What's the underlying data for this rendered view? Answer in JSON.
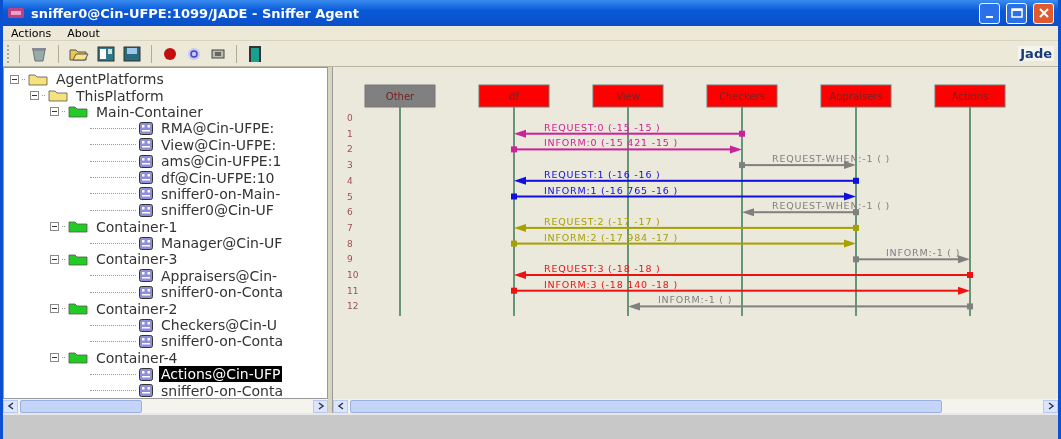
{
  "window": {
    "title": "sniffer0@Cin-UFPE:1099/JADE - Sniffer Agent"
  },
  "menu": [
    "Actions",
    "About"
  ],
  "toolbar": {
    "logo_text": "Jade"
  },
  "tree": [
    {
      "label": "AgentPlatforms",
      "kind": "folder",
      "expanded": true,
      "selected": false,
      "children": [
        {
          "label": "ThisPlatform",
          "kind": "folder",
          "expanded": true,
          "selected": false,
          "children": [
            {
              "label": "Main-Container",
              "kind": "container",
              "expanded": true,
              "selected": false,
              "children": [
                {
                  "label": "RMA@Cin-UFPE:",
                  "kind": "agent",
                  "selected": false
                },
                {
                  "label": "View@Cin-UFPE:",
                  "kind": "agent",
                  "selected": false
                },
                {
                  "label": "ams@Cin-UFPE:1",
                  "kind": "agent",
                  "selected": false
                },
                {
                  "label": "df@Cin-UFPE:10",
                  "kind": "agent",
                  "selected": false
                },
                {
                  "label": "sniffer0-on-Main-",
                  "kind": "agent",
                  "selected": false
                },
                {
                  "label": "sniffer0@Cin-UF",
                  "kind": "agent",
                  "selected": false
                }
              ]
            },
            {
              "label": "Container-1",
              "kind": "container",
              "expanded": true,
              "selected": false,
              "children": [
                {
                  "label": "Manager@Cin-UF",
                  "kind": "agent",
                  "selected": false
                }
              ]
            },
            {
              "label": "Container-3",
              "kind": "container",
              "expanded": true,
              "selected": false,
              "children": [
                {
                  "label": "Appraisers@Cin-",
                  "kind": "agent",
                  "selected": false
                },
                {
                  "label": "sniffer0-on-Conta",
                  "kind": "agent",
                  "selected": false
                }
              ]
            },
            {
              "label": "Container-2",
              "kind": "container",
              "expanded": true,
              "selected": false,
              "children": [
                {
                  "label": "Checkers@Cin-U",
                  "kind": "agent",
                  "selected": false
                },
                {
                  "label": "sniffer0-on-Conta",
                  "kind": "agent",
                  "selected": false
                }
              ]
            },
            {
              "label": "Container-4",
              "kind": "container",
              "expanded": true,
              "selected": false,
              "children": [
                {
                  "label": "Actions@Cin-UFP",
                  "kind": "agent",
                  "selected": true
                },
                {
                  "label": "sniffer0-on-Conta",
                  "kind": "agent",
                  "selected": false
                }
              ]
            }
          ]
        }
      ]
    }
  ],
  "diagram": {
    "agents": [
      {
        "name": "Other",
        "color": "#808080"
      },
      {
        "name": "df",
        "color": "#ff0000"
      },
      {
        "name": "View",
        "color": "#ff0000"
      },
      {
        "name": "Checkers",
        "color": "#ff0000"
      },
      {
        "name": "Appraisers",
        "color": "#ff0000"
      },
      {
        "name": "Actions",
        "color": "#ff0000"
      }
    ],
    "row_numbers": [
      "0",
      "1",
      "2",
      "3",
      "4",
      "5",
      "6",
      "7",
      "8",
      "9",
      "10",
      "11",
      "12"
    ],
    "messages": [
      {
        "label": "REQUEST:0 (-15 -15 )",
        "kind": "leftward",
        "covers": [
          false,
          true,
          true,
          true,
          false,
          false
        ],
        "color": "#cc2299"
      },
      {
        "label": "INFORM:0 (-15 421 -15 )",
        "kind": "rightward",
        "covers": [
          false,
          true,
          true,
          true,
          false,
          false
        ],
        "color": "#cc2299"
      },
      {
        "label": "REQUEST-WHEN:-1 ( )",
        "kind": "rightward",
        "covers": [
          false,
          false,
          false,
          true,
          true,
          false
        ],
        "color": "#808080"
      },
      {
        "label": "REQUEST:1 (-16 -16 )",
        "kind": "leftward",
        "covers": [
          false,
          true,
          true,
          true,
          true,
          false
        ],
        "color": "#1010dd"
      },
      {
        "label": "INFORM:1 (-16 765 -16 )",
        "kind": "rightward",
        "covers": [
          false,
          true,
          true,
          true,
          true,
          false
        ],
        "color": "#1010dd"
      },
      {
        "label": "REQUEST-WHEN:-1 ( )",
        "kind": "leftward",
        "covers": [
          false,
          false,
          false,
          true,
          true,
          false
        ],
        "color": "#808080"
      },
      {
        "label": "REQUEST:2 (-17 -17 )",
        "kind": "leftward",
        "covers": [
          false,
          true,
          true,
          true,
          true,
          false
        ],
        "color": "#a8a000"
      },
      {
        "label": "INFORM:2 (-17 984 -17 )",
        "kind": "rightward",
        "covers": [
          false,
          true,
          true,
          true,
          true,
          false
        ],
        "color": "#a8a000"
      },
      {
        "label": "INFORM:-1 ( )",
        "kind": "rightward",
        "covers": [
          false,
          false,
          false,
          false,
          true,
          true
        ],
        "color": "#808080"
      },
      {
        "label": "REQUEST:3 (-18 -18 )",
        "kind": "leftward",
        "covers": [
          false,
          true,
          true,
          true,
          true,
          true
        ],
        "color": "#ee1111"
      },
      {
        "label": "INFORM:3 (-18 140 -18 )",
        "kind": "rightward",
        "covers": [
          false,
          true,
          true,
          true,
          true,
          true
        ],
        "color": "#ee1111"
      },
      {
        "label": "INFORM:-1 ( )",
        "kind": "leftward",
        "covers": [
          false,
          false,
          true,
          true,
          true,
          true
        ],
        "color": "#808080"
      }
    ]
  }
}
